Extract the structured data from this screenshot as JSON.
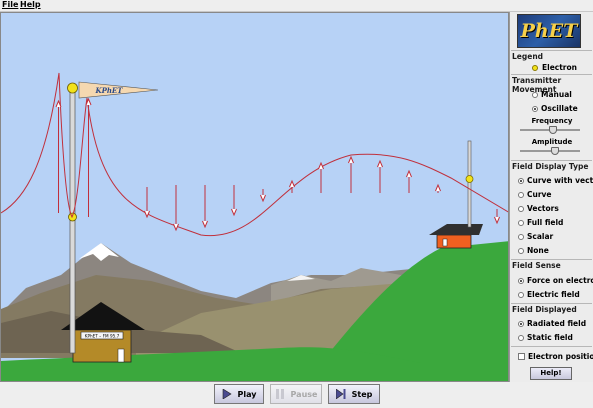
{
  "menu": {
    "file": "File",
    "help": "Help"
  },
  "scene": {
    "sky_color": "#b7d2f6",
    "flag_text": "KPhET",
    "house_sign": "KPhET – FM 95.7"
  },
  "panel": {
    "logo_text": "PhET",
    "legend": {
      "title": "Legend",
      "electron": "Electron"
    },
    "transmitter": {
      "title": "Transmitter Movement",
      "options": [
        "Manual",
        "Oscillate"
      ],
      "selected": "Oscillate",
      "frequency_label": "Frequency",
      "frequency_level": 0.55,
      "amplitude_label": "Amplitude",
      "amplitude_level": 0.6
    },
    "field_display": {
      "title": "Field Display Type",
      "options": [
        "Curve with vectors",
        "Curve",
        "Vectors",
        "Full field",
        "Scalar",
        "None"
      ],
      "selected": "Curve with vectors"
    },
    "field_sense": {
      "title": "Field Sense",
      "options": [
        "Force on electron",
        "Electric field"
      ],
      "selected": "Force on electron"
    },
    "field_displayed": {
      "title": "Field Displayed",
      "options": [
        "Radiated field",
        "Static field"
      ],
      "selected": "Radiated field"
    },
    "electron_positions": "Electron positions",
    "help_button": "Help!"
  },
  "controls": {
    "play": "Play",
    "pause": "Pause",
    "step": "Step"
  },
  "colors": {
    "wave": "#c0303c",
    "electron": "#f2e21a",
    "grass": "#39a83a",
    "accent": "#f6d04a"
  }
}
